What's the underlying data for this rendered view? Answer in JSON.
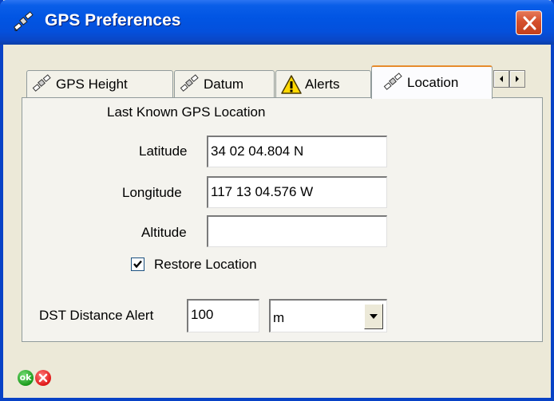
{
  "window": {
    "title": "GPS Preferences",
    "title_icon": "satellite-icon",
    "close_icon": "close-icon"
  },
  "tabs": [
    {
      "label": "GPS Height",
      "icon": "satellite-icon"
    },
    {
      "label": "Datum",
      "icon": "satellite-icon"
    },
    {
      "label": "Alerts",
      "icon": "warning-icon"
    },
    {
      "label": "Location",
      "icon": "satellite-icon",
      "active": true
    }
  ],
  "tab_scroll": {
    "left_icon": "arrow-left-icon",
    "right_icon": "arrow-right-icon"
  },
  "location": {
    "section_title": "Last Known GPS Location",
    "latitude_label": "Latitude",
    "latitude_value": "34 02 04.804 N",
    "longitude_label": "Longitude",
    "longitude_value": "117 13 04.576 W",
    "altitude_label": "Altitude",
    "altitude_value": "",
    "restore_label": "Restore Location",
    "restore_checked": true,
    "dst_label": "DST Distance Alert",
    "dst_value": "100",
    "unit_value": "m"
  },
  "footer": {
    "ok_label": "ok"
  },
  "colors": {
    "titlebar": "#0155e3",
    "active_tab_accent": "#e68b2c",
    "ok": "#1a9a1a",
    "cancel": "#e01818"
  }
}
